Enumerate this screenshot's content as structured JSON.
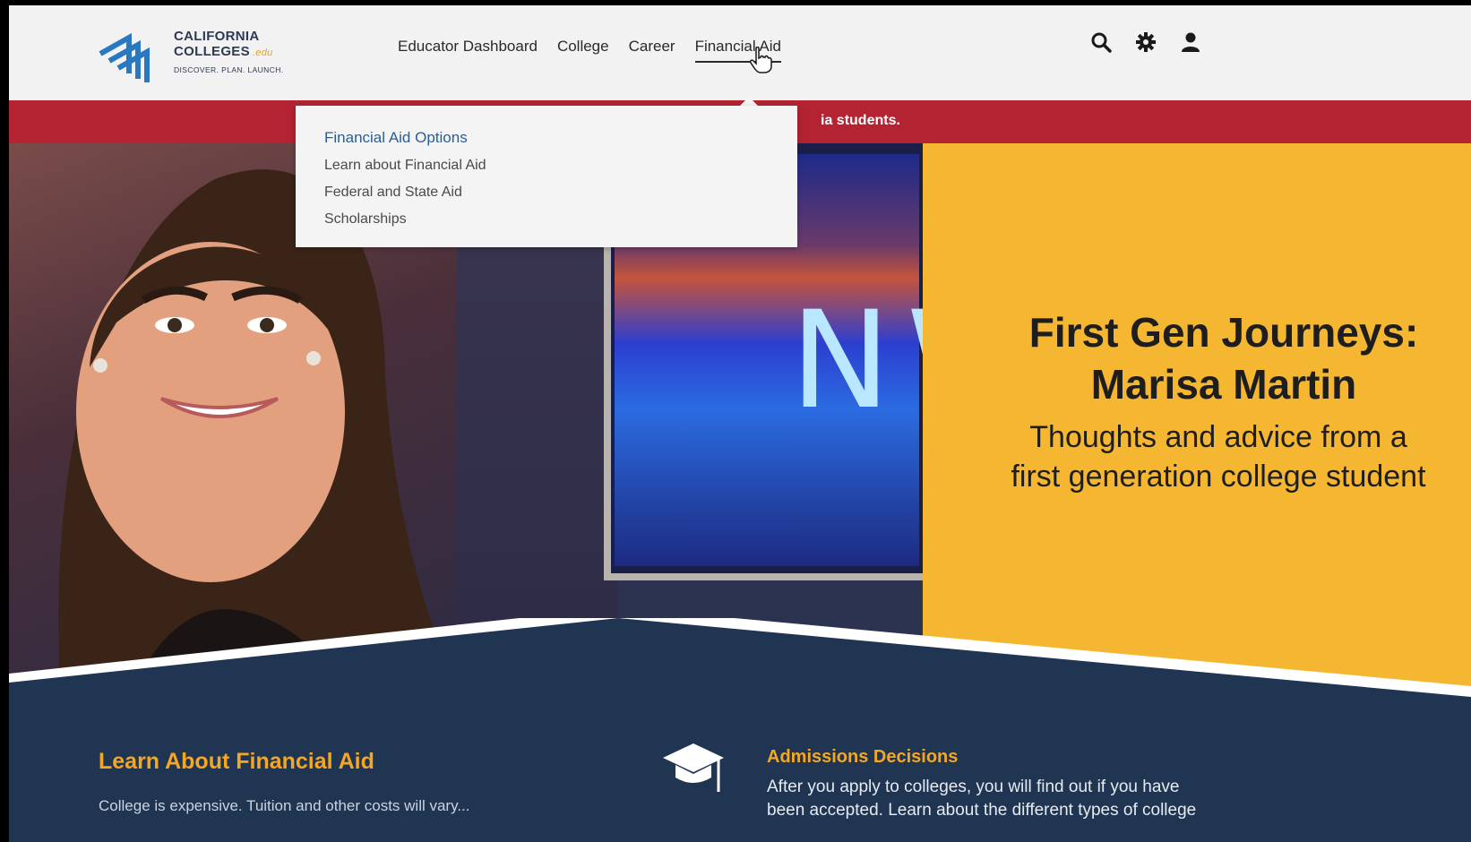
{
  "logo": {
    "line1": "CALIFORNIA",
    "line2": "COLLEGES",
    "suffix": ".edu",
    "tagline": "DISCOVER. PLAN. LAUNCH."
  },
  "nav": {
    "items": [
      "Educator Dashboard",
      "College",
      "Career",
      "Financial Aid"
    ],
    "active": "Financial Aid"
  },
  "header_icons": [
    "search-icon",
    "gear-icon",
    "user-icon"
  ],
  "ribbon": {
    "text": "ia students."
  },
  "dropdown": {
    "heading": "Financial Aid Options",
    "items": [
      "Learn about Financial Aid",
      "Federal and State Aid",
      "Scholarships"
    ]
  },
  "hero": {
    "tv_text": "NW",
    "title_line1": "First Gen Journeys:",
    "title_line2": "Marisa Martin",
    "subtitle_line1": "Thoughts and advice from a",
    "subtitle_line2": "first generation college student"
  },
  "sections": {
    "learn_title": "Learn About Financial Aid",
    "learn_body": "College is expensive. Tuition and other costs will vary...",
    "admissions_title": "Admissions Decisions",
    "admissions_body": "After you apply to colleges, you will find out if you have been accepted. Learn about the different types of college"
  },
  "colors": {
    "accent_red": "#b32331",
    "hero_yellow": "#f5b731",
    "section_orange": "#f5a623",
    "band_navy": "#1f3552"
  }
}
